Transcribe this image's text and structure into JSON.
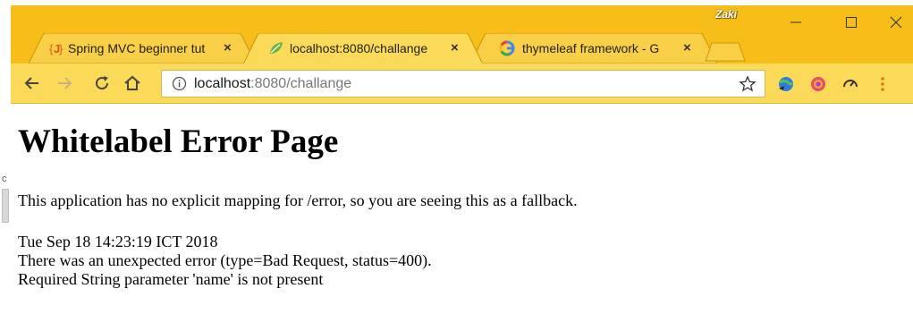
{
  "background_window": {
    "edge_glyph": "c"
  },
  "tabs": [
    {
      "title": "Spring MVC beginner tut",
      "active": false,
      "favicon": "jetbrains-j-icon",
      "close": "×"
    },
    {
      "title": "localhost:8080/challange",
      "active": true,
      "favicon": "spring-leaf-icon",
      "close": "×"
    },
    {
      "title": "thymeleaf framework - G",
      "active": false,
      "favicon": "google-g-icon",
      "close": "×"
    }
  ],
  "profile_name": "Zaki",
  "toolbar": {
    "url_host": "localhost",
    "url_rest": ":8080/challange"
  },
  "page": {
    "heading": "Whitelabel Error Page",
    "message": "This application has no explicit mapping for /error, so you are seeing this as a fallback.",
    "timestamp": "Tue Sep 18 14:23:19 ICT 2018",
    "error_line": "There was an unexpected error (type=Bad Request, status=400).",
    "detail_line": "Required String parameter 'name' is not present"
  },
  "colors": {
    "theme_frame": "#f7bd19",
    "theme_toolbar": "#fbda5a",
    "window_close": "#f7bd19"
  }
}
